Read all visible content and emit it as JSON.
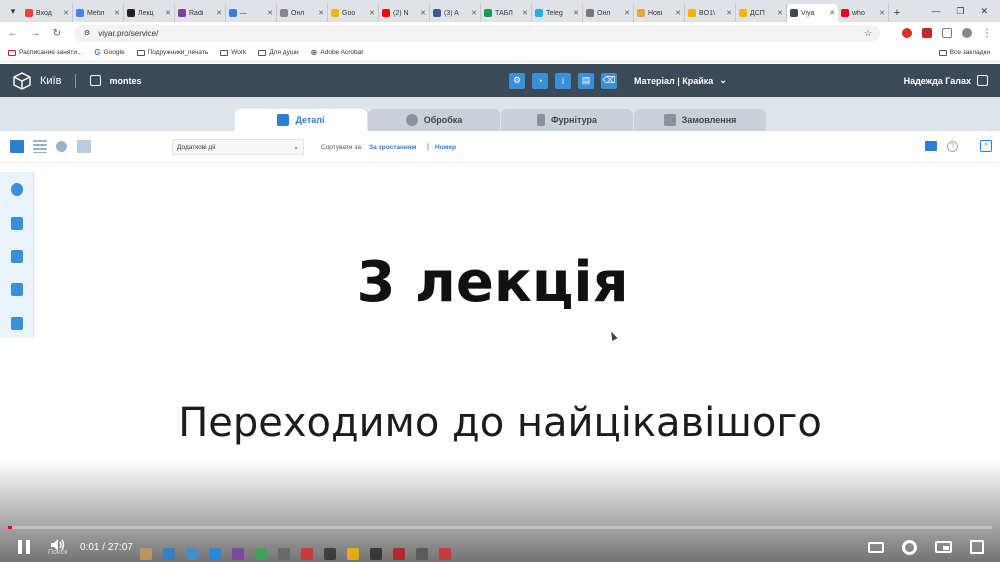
{
  "browser": {
    "tabs": [
      {
        "label": "Вход",
        "color": "#ea4335"
      },
      {
        "label": "Мебл",
        "color": "#4285f4"
      },
      {
        "label": "Лекц",
        "color": "#222222"
      },
      {
        "label": "Radi",
        "color": "#7b3fa0"
      },
      {
        "label": "—",
        "color": "#3b7dd8"
      },
      {
        "label": "Онл",
        "color": "#888888"
      },
      {
        "label": "Goo",
        "color": "#f4b400"
      },
      {
        "label": "(2) N",
        "color": "#ff0000"
      },
      {
        "label": "(3) A",
        "color": "#3b5998"
      },
      {
        "label": "ТАБЛ",
        "color": "#0f9d58"
      },
      {
        "label": "Teleg",
        "color": "#2aabee"
      },
      {
        "label": "Онл",
        "color": "#777777"
      },
      {
        "label": "Нові",
        "color": "#e8a33b"
      },
      {
        "label": "BO1\\",
        "color": "#f4b400"
      },
      {
        "label": "ДСП",
        "color": "#f4b400"
      },
      {
        "label": "Viya",
        "color": "#3b4a58"
      },
      {
        "label": "who",
        "color": "#e60023"
      }
    ],
    "active_tab_index": 15,
    "url": "viyar.pro/service/",
    "bookmarks": [
      {
        "label": "Расписание заняти..."
      },
      {
        "label": "Google"
      },
      {
        "label": "Подружники_печать"
      },
      {
        "label": "Work"
      },
      {
        "label": "Для души"
      },
      {
        "label": "Adobe Acrobat"
      }
    ],
    "all_bookmarks": "Все закладки"
  },
  "app": {
    "city": "Київ",
    "brand": "montes",
    "material_menu": "Матеріал | Крайка",
    "user_name": "Надежда Галах"
  },
  "section_tabs": [
    {
      "label": "Деталі",
      "active": true
    },
    {
      "label": "Обробка",
      "active": false
    },
    {
      "label": "Фурнітура",
      "active": false
    },
    {
      "label": "Замовлення",
      "active": false
    }
  ],
  "toolbar": {
    "select_value": "Додаткові дії",
    "sort_label": "Сортувати за:",
    "sort_option_1": "За зростанням",
    "sort_separator": "|",
    "sort_option_2": "Номер"
  },
  "overlay": {
    "title": "3 лекція",
    "subtitle": "Переходимо до найцікавішого"
  },
  "video": {
    "current_time": "0:01",
    "separator": "/",
    "duration": "27:07",
    "progress_fraction": 0.0006
  },
  "taskbar": {
    "search_label": "Поиск"
  },
  "colors": {
    "header_bg": "#3b4a58",
    "accent": "#2b7fd0",
    "tool_blue": "#3a8fd8",
    "progress_red": "#ff0000"
  }
}
